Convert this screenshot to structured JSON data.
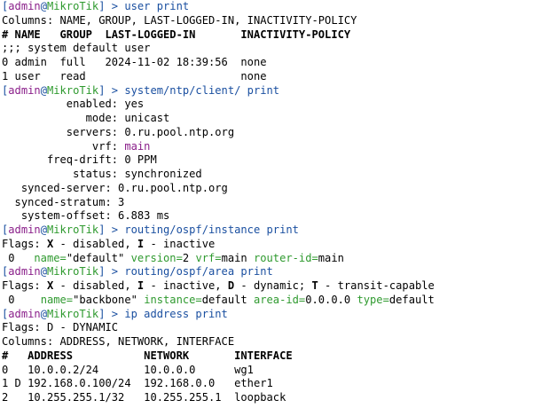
{
  "terminal": {
    "prompt": {
      "user": "admin",
      "at": "@",
      "host": "MikroTik",
      "open": "[",
      "close": "]",
      "arrow": " > "
    },
    "lines": [
      {
        "segs": [
          {
            "t": "[",
            "c": "blue"
          },
          {
            "t": "admin",
            "c": "purple"
          },
          {
            "t": "@",
            "c": "blue"
          },
          {
            "t": "MikroTik",
            "c": "green"
          },
          {
            "t": "] > ",
            "c": "blue"
          },
          {
            "t": "user print",
            "c": "blue"
          }
        ]
      },
      {
        "segs": [
          {
            "t": "Columns: NAME, GROUP, LAST-LOGGED-IN, INACTIVITY-POLICY"
          }
        ]
      },
      {
        "segs": [
          {
            "t": "# NAME   GROUP  LAST-LOGGED-IN       INACTIVITY-POLICY",
            "b": true
          }
        ]
      },
      {
        "segs": [
          {
            "t": ";;; system default user"
          }
        ]
      },
      {
        "segs": [
          {
            "t": "0 admin  full   2024-11-02 18:39:56  none"
          }
        ]
      },
      {
        "segs": [
          {
            "t": "1 user   read                        none"
          }
        ]
      },
      {
        "segs": [
          {
            "t": "[",
            "c": "blue"
          },
          {
            "t": "admin",
            "c": "purple"
          },
          {
            "t": "@",
            "c": "blue"
          },
          {
            "t": "MikroTik",
            "c": "green"
          },
          {
            "t": "] > ",
            "c": "blue"
          },
          {
            "t": "system/ntp/client/ print",
            "c": "blue"
          }
        ]
      },
      {
        "segs": [
          {
            "t": "          enabled: yes"
          }
        ]
      },
      {
        "segs": [
          {
            "t": "             mode: unicast"
          }
        ]
      },
      {
        "segs": [
          {
            "t": "          servers: 0.ru.pool.ntp.org"
          }
        ]
      },
      {
        "segs": [
          {
            "t": "              vrf: "
          },
          {
            "t": "main",
            "c": "purple"
          }
        ]
      },
      {
        "segs": [
          {
            "t": "       freq-drift: 0 PPM"
          }
        ]
      },
      {
        "segs": [
          {
            "t": "           status: synchronized"
          }
        ]
      },
      {
        "segs": [
          {
            "t": "   synced-server: 0.ru.pool.ntp.org"
          }
        ]
      },
      {
        "segs": [
          {
            "t": "  synced-stratum: 3"
          }
        ]
      },
      {
        "segs": [
          {
            "t": "   system-offset: 6.883 ms"
          }
        ]
      },
      {
        "segs": [
          {
            "t": "[",
            "c": "blue"
          },
          {
            "t": "admin",
            "c": "purple"
          },
          {
            "t": "@",
            "c": "blue"
          },
          {
            "t": "MikroTik",
            "c": "green"
          },
          {
            "t": "] > ",
            "c": "blue"
          },
          {
            "t": "routing/ospf/instance print",
            "c": "blue"
          }
        ]
      },
      {
        "segs": [
          {
            "t": "Flags: "
          },
          {
            "t": "X",
            "b": true
          },
          {
            "t": " - disabled, "
          },
          {
            "t": "I",
            "b": true
          },
          {
            "t": " - inactive"
          }
        ]
      },
      {
        "segs": [
          {
            "t": " 0   "
          },
          {
            "t": "name=",
            "c": "green"
          },
          {
            "t": "\"default\" "
          },
          {
            "t": "version=",
            "c": "green"
          },
          {
            "t": "2 "
          },
          {
            "t": "vrf=",
            "c": "green"
          },
          {
            "t": "main "
          },
          {
            "t": "router-id=",
            "c": "green"
          },
          {
            "t": "main"
          }
        ]
      },
      {
        "segs": [
          {
            "t": "[",
            "c": "blue"
          },
          {
            "t": "admin",
            "c": "purple"
          },
          {
            "t": "@",
            "c": "blue"
          },
          {
            "t": "MikroTik",
            "c": "green"
          },
          {
            "t": "] > ",
            "c": "blue"
          },
          {
            "t": "routing/ospf/area print",
            "c": "blue"
          }
        ]
      },
      {
        "segs": [
          {
            "t": "Flags: "
          },
          {
            "t": "X",
            "b": true
          },
          {
            "t": " - disabled, "
          },
          {
            "t": "I",
            "b": true
          },
          {
            "t": " - inactive, "
          },
          {
            "t": "D",
            "b": true
          },
          {
            "t": " - dynamic; "
          },
          {
            "t": "T",
            "b": true
          },
          {
            "t": " - transit-capable"
          }
        ]
      },
      {
        "segs": [
          {
            "t": " 0    "
          },
          {
            "t": "name=",
            "c": "green"
          },
          {
            "t": "\"backbone\" "
          },
          {
            "t": "instance=",
            "c": "green"
          },
          {
            "t": "default "
          },
          {
            "t": "area-id=",
            "c": "green"
          },
          {
            "t": "0.0.0.0 "
          },
          {
            "t": "type=",
            "c": "green"
          },
          {
            "t": "default"
          }
        ]
      },
      {
        "segs": [
          {
            "t": "[",
            "c": "blue"
          },
          {
            "t": "admin",
            "c": "purple"
          },
          {
            "t": "@",
            "c": "blue"
          },
          {
            "t": "MikroTik",
            "c": "green"
          },
          {
            "t": "] > ",
            "c": "blue"
          },
          {
            "t": "ip address print",
            "c": "blue"
          }
        ]
      },
      {
        "segs": [
          {
            "t": "Flags: D - DYNAMIC"
          }
        ]
      },
      {
        "segs": [
          {
            "t": "Columns: ADDRESS, NETWORK, INTERFACE"
          }
        ]
      },
      {
        "segs": [
          {
            "t": "#   ADDRESS           NETWORK       INTERFACE",
            "b": true
          }
        ]
      },
      {
        "segs": [
          {
            "t": "0   10.0.0.2/24       10.0.0.0      wg1"
          }
        ]
      },
      {
        "segs": [
          {
            "t": "1 D 192.168.0.100/24  192.168.0.0   ether1"
          }
        ]
      },
      {
        "segs": [
          {
            "t": "2   10.255.255.1/32   10.255.255.1  loopback"
          }
        ]
      }
    ]
  },
  "colors": {
    "blue": "#1a4fa0",
    "purple": "#8a1f8a",
    "green": "#2f9a2f",
    "text": "#000000",
    "background": "#ffffff"
  }
}
